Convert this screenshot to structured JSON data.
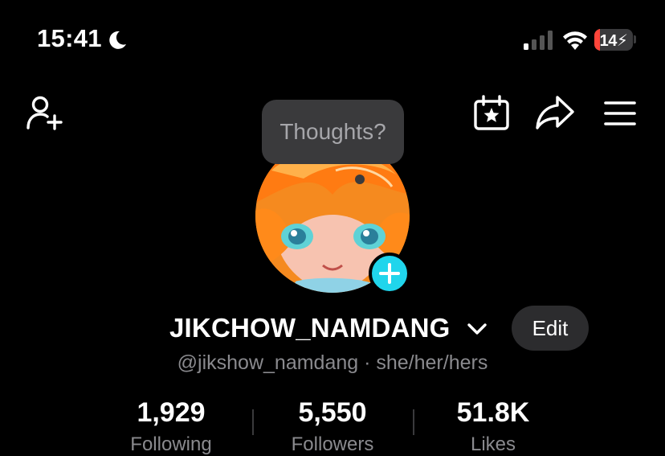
{
  "status_bar": {
    "time": "15:41",
    "focus_icon": "moon-icon",
    "signal_icon": "cellular-signal-icon",
    "wifi_icon": "wifi-icon",
    "battery_level": "14",
    "battery_charging": true,
    "battery_low_color": "#ff453a"
  },
  "top_bar": {
    "left_icon": "add-user-icon",
    "right_icons": [
      "calendar-star-icon",
      "share-icon",
      "menu-icon"
    ]
  },
  "tooltip": {
    "text": "Thoughts?"
  },
  "profile": {
    "username": "JIKCHOW_NAMDANG",
    "handle_and_pronouns": "@jikshow_namdang · she/her/hers",
    "edit_label": "Edit",
    "add_story_icon": "plus-icon",
    "accent_color": "#20d5ec"
  },
  "stats": [
    {
      "value": "1,929",
      "label": "Following"
    },
    {
      "value": "5,550",
      "label": "Followers"
    },
    {
      "value": "51.8K",
      "label": "Likes"
    }
  ]
}
